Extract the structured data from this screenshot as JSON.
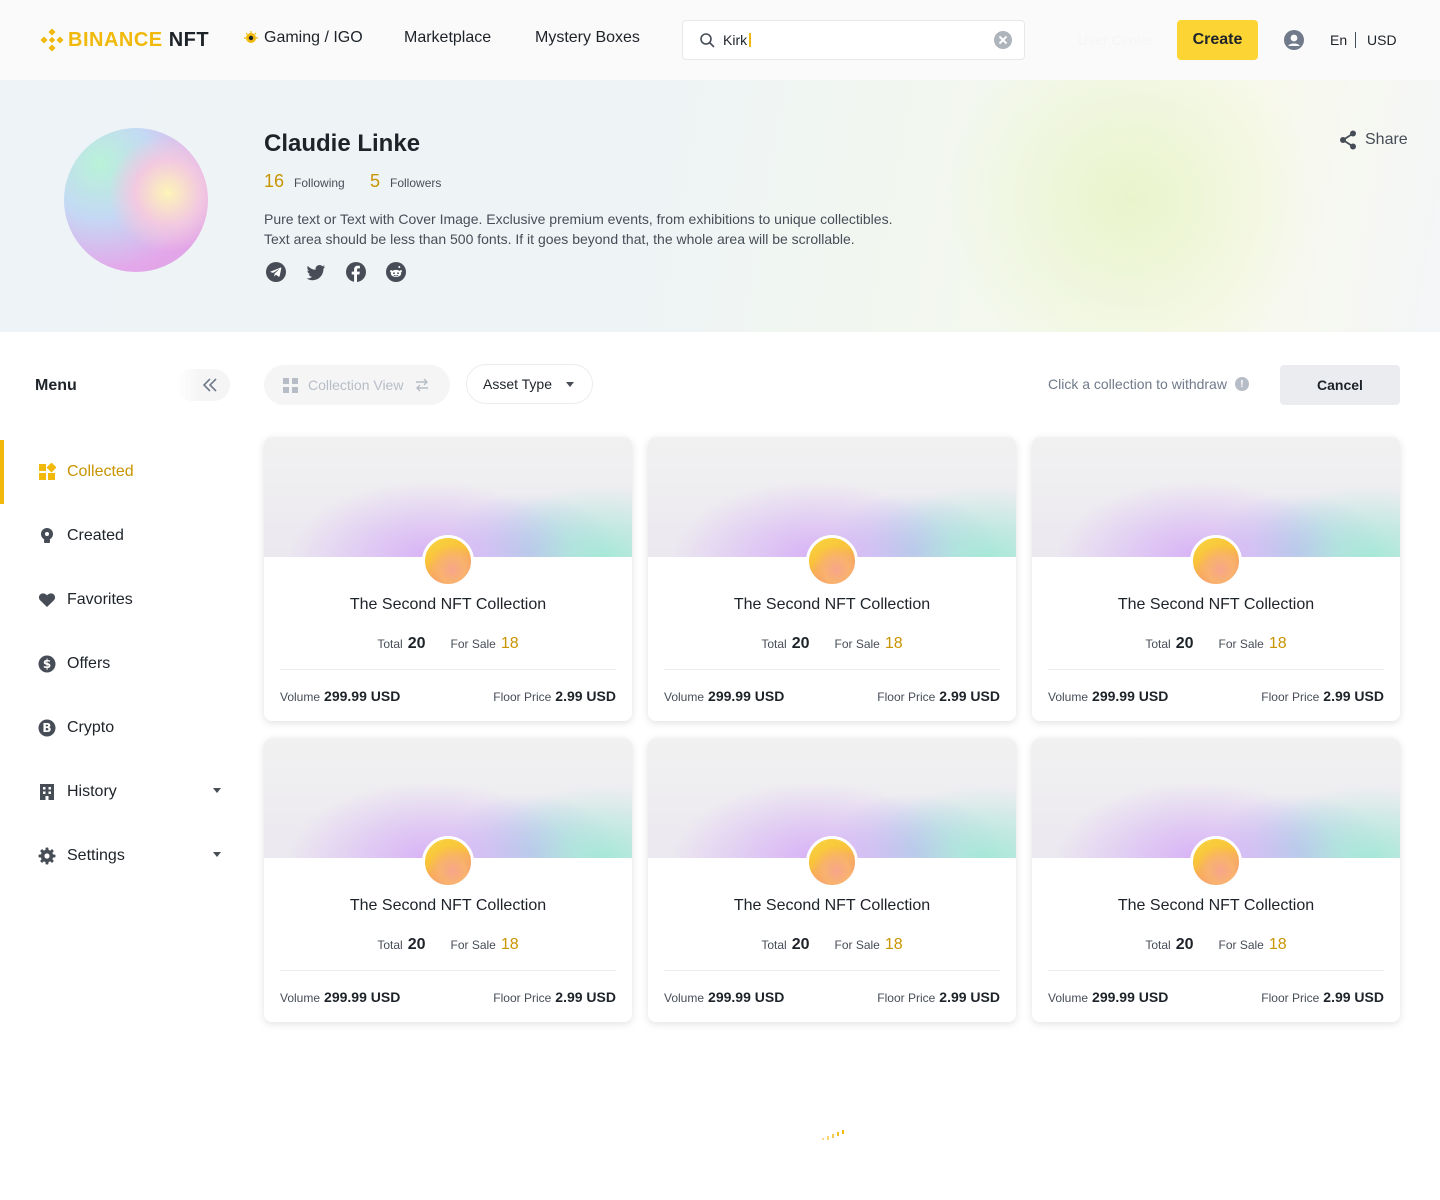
{
  "header": {
    "logo_brand": "BINANCE",
    "logo_suffix": "NFT",
    "nav": {
      "gaming": "Gaming / IGO",
      "marketplace": "Marketplace",
      "mystery_boxes": "Mystery Boxes"
    },
    "search": {
      "value": "Kirk",
      "placeholder": ""
    },
    "user_center": "User Center",
    "create_label": "Create",
    "language": "En",
    "currency": "USD"
  },
  "profile": {
    "name": "Claudie Linke",
    "following_count": "16",
    "following_label": "Following",
    "followers_count": "5",
    "followers_label": "Followers",
    "bio_line1": "Pure text or Text with Cover Image. Exclusive premium events, from exhibitions to unique collectibles.",
    "bio_line2": "Text area should be less than 500 fonts. If it goes beyond that, the whole area will be scrollable.",
    "share_label": "Share",
    "socials": [
      "telegram-icon",
      "twitter-icon",
      "facebook-icon",
      "reddit-icon"
    ]
  },
  "sidebar": {
    "title": "Menu",
    "items": [
      {
        "label": "Collected",
        "icon": "grid-icon",
        "active": true
      },
      {
        "label": "Created",
        "icon": "bulb-icon"
      },
      {
        "label": "Favorites",
        "icon": "heart-icon"
      },
      {
        "label": "Offers",
        "icon": "dollar-icon"
      },
      {
        "label": "Crypto",
        "icon": "bitcoin-icon"
      },
      {
        "label": "History",
        "icon": "building-icon",
        "expandable": true
      },
      {
        "label": "Settings",
        "icon": "gear-icon",
        "expandable": true
      }
    ]
  },
  "toolbar": {
    "view_label": "Collection View",
    "asset_type_label": "Asset Type",
    "withdraw_hint": "Click a collection to withdraw",
    "cancel_label": "Cancel"
  },
  "collections": [
    {
      "title": "The Second NFT Collection",
      "total_label": "Total",
      "total": "20",
      "sale_label": "For Sale",
      "for_sale": "18",
      "volume_label": "Volume",
      "volume": "299.99 USD",
      "floor_label": "Floor Price",
      "floor": "2.99 USD"
    },
    {
      "title": "The Second NFT Collection",
      "total_label": "Total",
      "total": "20",
      "sale_label": "For Sale",
      "for_sale": "18",
      "volume_label": "Volume",
      "volume": "299.99 USD",
      "floor_label": "Floor Price",
      "floor": "2.99 USD"
    },
    {
      "title": "The Second NFT Collection",
      "total_label": "Total",
      "total": "20",
      "sale_label": "For Sale",
      "for_sale": "18",
      "volume_label": "Volume",
      "volume": "299.99 USD",
      "floor_label": "Floor Price",
      "floor": "2.99 USD"
    },
    {
      "title": "The Second NFT Collection",
      "total_label": "Total",
      "total": "20",
      "sale_label": "For Sale",
      "for_sale": "18",
      "volume_label": "Volume",
      "volume": "299.99 USD",
      "floor_label": "Floor Price",
      "floor": "2.99 USD"
    },
    {
      "title": "The Second NFT Collection",
      "total_label": "Total",
      "total": "20",
      "sale_label": "For Sale",
      "for_sale": "18",
      "volume_label": "Volume",
      "volume": "299.99 USD",
      "floor_label": "Floor Price",
      "floor": "2.99 USD"
    },
    {
      "title": "The Second NFT Collection",
      "total_label": "Total",
      "total": "20",
      "sale_label": "For Sale",
      "for_sale": "18",
      "volume_label": "Volume",
      "volume": "299.99 USD",
      "floor_label": "Floor Price",
      "floor": "2.99 USD"
    }
  ],
  "colors": {
    "brand_yellow": "#f0b90b",
    "button_yellow": "#fcd535",
    "accent_text": "#c99400",
    "text_primary": "#1e2329",
    "text_secondary": "#474d57"
  }
}
